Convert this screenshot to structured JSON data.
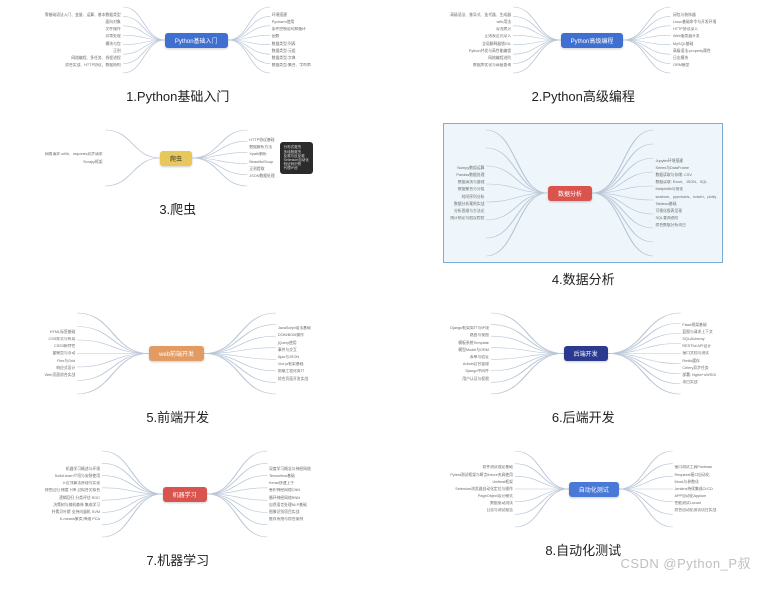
{
  "watermark": "CSDN @Python_P叔",
  "items": [
    {
      "caption": "1.Python基础入门",
      "central": "Python基础入门",
      "central_bg": "#3f6fd1",
      "thumb_h": 80,
      "left": [
        "零基础语法入门、变量、运算、基本数据类型",
        "面向对象",
        "文件操作",
        "异常处理",
        "模块与包",
        "正则",
        "网络编程、多任务、线程进程",
        "综合实战、HTTP协议、数据结构"
      ],
      "right": [
        "环境搭建",
        "Pycharm使用",
        "条件控制语句和循环",
        "函数",
        "数据类型:列表",
        "数据类型:元组",
        "数据类型:字典",
        "数据类型:集合、字符串"
      ]
    },
    {
      "caption": "2.Python高级编程",
      "central": "Python高级编程",
      "central_bg": "#3f6fd1",
      "thumb_h": 80,
      "left": [
        "高级语法、推导式、迭代器、生成器",
        "with用法",
        "深浅拷贝",
        "正则表达式深入",
        "全局解释器锁GIL",
        "Python并发与高性能编程",
        "网络编程进阶",
        "数据库优化与高级查询"
      ],
      "right": [
        "闭包与装饰器",
        "Linux基础命令与开发环境",
        "HTTP协议深入",
        "Web服务器开发",
        "MySQL基础",
        "高级语法:property属性",
        "日志模块",
        "ORM模型"
      ]
    },
    {
      "caption": "3.爬虫",
      "central": "爬虫",
      "central_bg": "#e8c85a",
      "central_fg": "#333",
      "thumb_h": 70,
      "left": [
        "网络请求 urllib、requests异步请求",
        "Scrapy框架"
      ],
      "right": [
        "HTTP协议基础",
        "数据解析方法",
        "Xpath解析",
        "BeautifulSoup",
        "正则提取",
        "JSON数据处理"
      ],
      "rightbox": [
        "分布式爬虫",
        "多线程爬虫",
        "反爬与反反爬",
        "Selenium自动化",
        "验证码识别",
        "代理IP池"
      ]
    },
    {
      "caption": "4.数据分析",
      "central": "数据分析",
      "central_bg": "#d9534f",
      "thumb_h": 140,
      "selected": true,
      "left": [
        "Numpy数组运算",
        "Pandas数据处理",
        "数据清洗与整理",
        "数据聚合与分组",
        "时间序列分析",
        "数据分析案例实战",
        "分析思维与方法论",
        "统计结论与假设检验"
      ],
      "right": [
        "Jupyter环境搭建",
        "Series与DataFrame",
        "数据读取与存储: CSV",
        "数据读取: Excel、JSON、SQL",
        "Matplotlib可视化",
        "seaborn、pyecharts、bokeh、plotly",
        "Tableau基础",
        "可视化报表呈现",
        "SQL查询进阶",
        "综合数据分析项目"
      ]
    },
    {
      "caption": "5.前端开发",
      "central": "web前端开发",
      "central_bg": "#e29b63",
      "thumb_h": 95,
      "left": [
        "HTML标签基础",
        "CSS样式与布局",
        "CSS3新特性",
        "盒模型与浮动",
        "Flex与Grid",
        "响应式设计",
        "Web页面综合实战"
      ],
      "right": [
        "JavaScript语法基础",
        "DOM/BOM操作",
        "jQuery使用",
        "事件与交互",
        "Ajax与JSON",
        "Vue.js框架基础",
        "前端工程化简介",
        "综合页面开发实战"
      ]
    },
    {
      "caption": "6.后端开发",
      "central": "后端开发",
      "central_bg": "#2b3a8e",
      "thumb_h": 95,
      "left": [
        "Django框架简介与环境",
        "路由与视图",
        "模板系统Template",
        "模型Model与ORM",
        "表单与验证",
        "Admin后台管理",
        "Django中间件",
        "用户认证与权限"
      ],
      "right": [
        "Flask框架基础",
        "蓝图与请求上下文",
        "SQLAlchemy",
        "RESTful API设计",
        "接口文档与测试",
        "Redis缓存",
        "Celery异步任务",
        "部署: Nginx+uWSGI",
        "项目实战"
      ]
    },
    {
      "caption": "7.机器学习",
      "central": "机器学习",
      "central_bg": "#d9534f",
      "thumb_h": 100,
      "left": [
        "机器学习概述与环境",
        "Scikit-learn介绍与安装使用",
        "K近邻算法原理与实现",
        "线性回归 梯度下降 过拟合欠拟合",
        "逻辑回归 分类评估 ROC",
        "决策树与随机森林 集成学习",
        "朴素贝叶斯 支持向量机 SVM",
        "K-means聚类 降维 PCA"
      ],
      "right": [
        "深度学习概念与神经网络",
        "Tensorflow基础",
        "Keras快速上手",
        "卷积神经网络CNN",
        "循环神经网络RNN",
        "自然语言处理NLP基础",
        "图像识别项目实战",
        "推荐系统与综合案例"
      ]
    },
    {
      "caption": "8.自动化测试",
      "central": "自动化测试",
      "central_bg": "#4a78d6",
      "thumb_h": 90,
      "left": [
        "软件测试理论基础",
        "Pytest测试框架与断言fixture夹具使用",
        "Unittest框架",
        "Selenium浏览器自动化定位与操作",
        "PageObject设计模式",
        "数据驱动测试",
        "日志与测试报告"
      ],
      "right": [
        "接口测试工具Postman",
        "Requests接口自动化",
        "Mock与参数化",
        "Jenkins持续集成CI/CD",
        "APP自动化Appium",
        "性能测试Locust",
        "综合自动化测试项目实战"
      ]
    }
  ]
}
